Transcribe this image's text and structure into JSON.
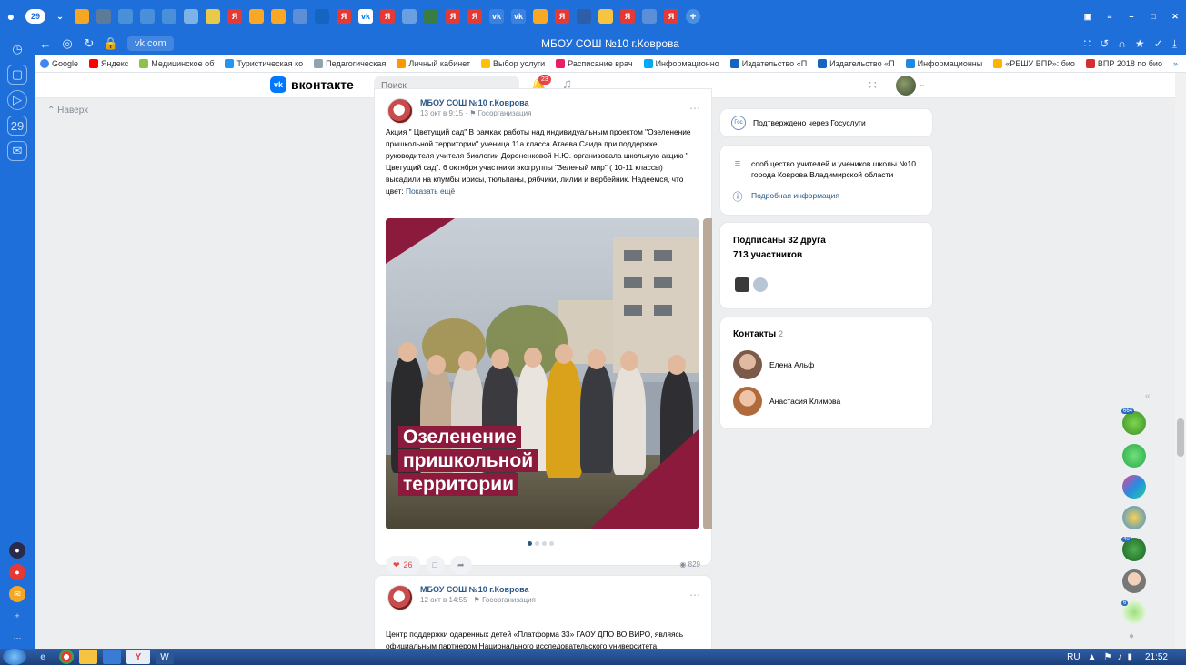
{
  "browser": {
    "tab_count_badge": "29",
    "url": "vk.com",
    "page_title": "МБОУ СОШ №10 г.Коврова",
    "bookmarks": [
      {
        "label": "Google",
        "color": "#4285f4"
      },
      {
        "label": "Яндекс",
        "color": "#ff0000"
      },
      {
        "label": "Медицинское об",
        "color": "#8bc34a"
      },
      {
        "label": "Туристическая ко",
        "color": "#2196f3"
      },
      {
        "label": "Педагогическая",
        "color": "#90a4ae"
      },
      {
        "label": "Личный кабинет",
        "color": "#ff9800"
      },
      {
        "label": "Выбор услуги",
        "color": "#ffc107"
      },
      {
        "label": "Расписание врач",
        "color": "#e91e63"
      },
      {
        "label": "Информационно",
        "color": "#03a9f4"
      },
      {
        "label": "Издательство «П",
        "color": "#1565c0"
      },
      {
        "label": "Издательство «П",
        "color": "#1565c0"
      },
      {
        "label": "Информационны",
        "color": "#1e88e5"
      },
      {
        "label": "«РЕШУ ВПР»: био",
        "color": "#ffb300"
      },
      {
        "label": "ВПР 2018 по био",
        "color": "#d32f2f"
      }
    ]
  },
  "vk": {
    "logo_text": "вконтакте",
    "search_placeholder": "Поиск",
    "notif_count": "23",
    "back_to_top": "Наверх"
  },
  "post1": {
    "author": "МБОУ СОШ №10 г.Коврова",
    "date": "13 окт в 9:15",
    "org_type": "Госорганизация",
    "text": "Акция \" Цветущий сад\" В рамках работы над индивидуальным проектом \"Озеленение пришкольной территории\" ученица 11а класса Атаева Саида при поддержке руководителя учителя биологии Дороненковой Н.Ю. организовала школьную акцию \" Цветущий сад\". 6 октября участники экогруппы \"Зеленый мир\" ( 10-11 классы) высадили на клумбы ирисы, тюльпаны, рябчики, лилии и вербейник. Надеемся, что цвет:",
    "show_more": "Показать ещё",
    "photo_title_lines": [
      "Озеленение",
      "пришкольной",
      "территории"
    ],
    "likes": "26",
    "views": "829"
  },
  "post2": {
    "author": "МБОУ СОШ №10 г.Коврова",
    "date": "12 окт в 14:55",
    "org_type": "Госорганизация",
    "text": "Центр поддержки одаренных детей «Платформа 33» ГАОУ ДПО ВО ВИРО, являясь официальным партнером Национального исследовательского университета «Московский институт электронной техники» (МИЭТ) в проведении"
  },
  "sidebar": {
    "gosuslugi": "Подтверждено через Госуслуги",
    "description": "сообщество учителей и учеников школы №10 города Коврова Владимирской области",
    "more_info": "Подробная информация",
    "friends_subscribed": "Подписаны 32 друга",
    "members": "713 участников",
    "contacts_title": "Контакты",
    "contacts_count": "2",
    "contacts": [
      {
        "name": "Елена Альф"
      },
      {
        "name": "Анастасия Климова"
      }
    ]
  },
  "right_panel": {
    "badges": [
      "664",
      "40",
      "6"
    ]
  },
  "taskbar": {
    "lang": "RU",
    "time": "21:52"
  },
  "colors": {
    "browser_blue": "#1e6fd9",
    "vk_blue": "#0077ff",
    "link": "#2a5885",
    "maroon": "#8b1a3c",
    "like_red": "#e64646"
  }
}
